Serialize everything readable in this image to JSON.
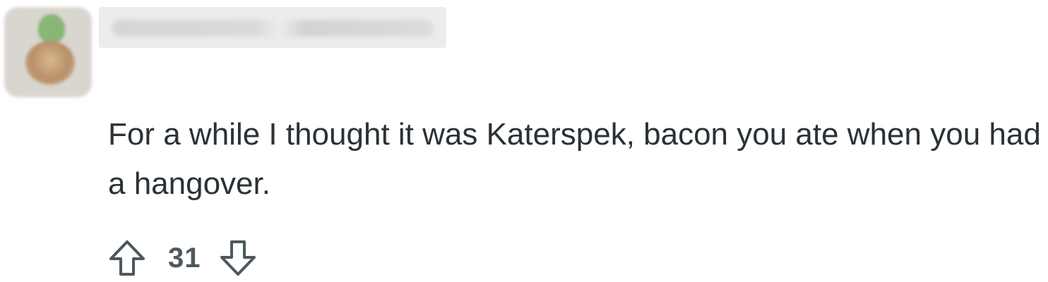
{
  "comment": {
    "body": "For a while I thought it was Katerspek, bacon you ate when you had a hangover.",
    "score": "31",
    "colors": {
      "text": "#2a3236",
      "icon": "#4d585e"
    },
    "icons": {
      "upvote": "arrow-up-outline",
      "downvote": "arrow-down-outline"
    }
  }
}
